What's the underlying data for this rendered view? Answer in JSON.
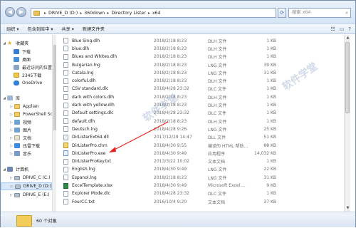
{
  "address": {
    "crumbs": [
      "DRIVE_D (D:)",
      "360down",
      "Directory Lister",
      "x64"
    ],
    "search_placeholder": "搜索 x64"
  },
  "toolbar": {
    "organize": "组织 ▾",
    "include": "包含到库中 ▾",
    "share": "共享 ▾",
    "new_folder": "新建文件夹"
  },
  "sidebar": {
    "favorites": "收藏夹",
    "download": "下载",
    "desktop": "桌面",
    "recent": "最近访问的位置",
    "folder2345": "2345下载",
    "onedrive": "OneDrive",
    "library": "库",
    "applian": "Applian",
    "powershell": "PowerShell Scri",
    "video": "视频",
    "pictures": "图片",
    "documents": "文档",
    "thunder": "迅雷下载",
    "music": "音乐",
    "computer": "计算机",
    "drive_c": "DRIVE_C (C:)",
    "drive_d": "DRIVE_D (D:)",
    "drive_e": "DRIVE_E (E:)"
  },
  "files": [
    {
      "name": "Blue Sing.dlh",
      "date": "2018/2/18 8:23",
      "type": "DLH 文件",
      "size": "1 KB",
      "icon": "dlh-file"
    },
    {
      "name": "blue.dlh",
      "date": "2018/2/18 8:23",
      "type": "DLH 文件",
      "size": "1 KB",
      "icon": "dlh-file"
    },
    {
      "name": "Blues and Whites.dlh",
      "date": "2018/2/18 8:23",
      "type": "DLH 文件",
      "size": "1 KB",
      "icon": "dlh-file"
    },
    {
      "name": "Bulgarian.lng",
      "date": "2018/2/18 8:23",
      "type": "LNG 文件",
      "size": "39 KB",
      "icon": "lng-file"
    },
    {
      "name": "Catala.lng",
      "date": "2018/2/18 8:23",
      "type": "LNG 文件",
      "size": "31 KB",
      "icon": "lng-file"
    },
    {
      "name": "colorful.dlh",
      "date": "2018/2/18 8:23",
      "type": "DLH 文件",
      "size": "1 KB",
      "icon": "dlh-file"
    },
    {
      "name": "CSV standard.dlc",
      "date": "2018/4/28 23:32",
      "type": "DLC 文件",
      "size": "1 KB",
      "icon": "dlc-file"
    },
    {
      "name": "dark with colors.dlh",
      "date": "2018/2/18 8:23",
      "type": "DLH 文件",
      "size": "1 KB",
      "icon": "dlh-file"
    },
    {
      "name": "dark with yellow.dlh",
      "date": "2018/2/18 8:23",
      "type": "DLH 文件",
      "size": "1 KB",
      "icon": "dlh-file"
    },
    {
      "name": "Default settings.dlc",
      "date": "2018/4/28 23:32",
      "type": "DLC 文件",
      "size": "1 KB",
      "icon": "dlc-file"
    },
    {
      "name": "default.dlh",
      "date": "2018/2/18 8:23",
      "type": "DLH 文件",
      "size": "1 KB",
      "icon": "dlh-file"
    },
    {
      "name": "Deutsch.lng",
      "date": "2018/4/28 9:26",
      "type": "LNG 文件",
      "size": "25 KB",
      "icon": "lng-file"
    },
    {
      "name": "DirListerExt64.dll",
      "date": "2017/12/29 14:47",
      "type": "DLL 文件",
      "size": "51 KB",
      "icon": "dll-file"
    },
    {
      "name": "DirListerPro.chm",
      "date": "2018/4/30 9:55",
      "type": "编译的 HTML 帮助...",
      "size": "88 KB",
      "icon": "chm-file"
    },
    {
      "name": "DirListerPro.exe",
      "date": "2018/4/30 9:49",
      "type": "应用程序",
      "size": "14,032 KB",
      "icon": "exe-file"
    },
    {
      "name": "DirListerProKey.txt",
      "date": "2013/3/22 10:02",
      "type": "文本文档",
      "size": "1 KB",
      "icon": "txt-file"
    },
    {
      "name": "English.lng",
      "date": "2018/4/30 9:49",
      "type": "LNG 文件",
      "size": "22 KB",
      "icon": "lng-file"
    },
    {
      "name": "Espanol.lng",
      "date": "2018/2/18 8:23",
      "type": "LNG 文件",
      "size": "31 KB",
      "icon": "lng-file"
    },
    {
      "name": "ExcelTemplate.xlsx",
      "date": "2018/4/30 9:49",
      "type": "Microsoft Excel ...",
      "size": "9 KB",
      "icon": "xlsx-file"
    },
    {
      "name": "Explorer Mode.dlc",
      "date": "2018/4/28 23:32",
      "type": "DLC 文件",
      "size": "1 KB",
      "icon": "dlc-file"
    },
    {
      "name": "FourCC.txt",
      "date": "2016/10/4 9:20",
      "type": "文本文档",
      "size": "37 KB",
      "icon": "txt-file"
    }
  ],
  "status": {
    "count": "60 个对象"
  },
  "watermark": "软件学堂"
}
